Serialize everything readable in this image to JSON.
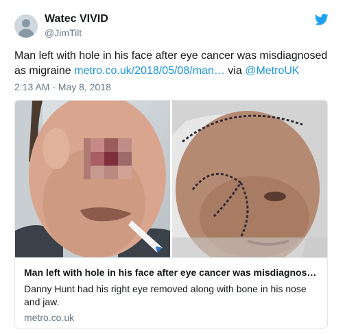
{
  "user": {
    "display_name": "Watec VIVID",
    "handle": "@JimTilt"
  },
  "tweet": {
    "text_main": "Man left with hole in his face after eye cancer was misdiagnosed as migraine",
    "link_text": "metro.co.uk/2018/05/08/man…",
    "via_text": "via",
    "mention": "@MetroUK",
    "timestamp": "2:13 AM - May 8, 2018"
  },
  "card": {
    "title": "Man left with hole in his face after eye cancer was misdiagnos…",
    "description": "Danny Hunt had his right eye removed along with bone in his nose and jaw.",
    "domain": "metro.co.uk"
  },
  "icons": {
    "brand": "twitter-bird-icon",
    "avatar": "default-avatar-icon"
  },
  "colors": {
    "link": "#1b95e0",
    "secondary_text": "#657786",
    "border": "#e1e8ed",
    "brand": "#1da1f2"
  }
}
